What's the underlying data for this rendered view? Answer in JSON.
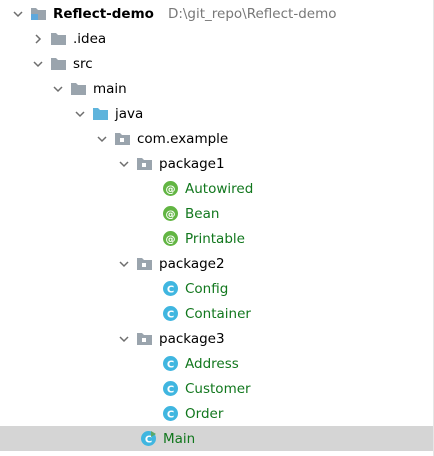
{
  "tree": {
    "root": {
      "label": "Reflect-demo",
      "path": "D:\\git_repo\\Reflect-demo"
    },
    "idea": {
      "label": ".idea"
    },
    "src": {
      "label": "src"
    },
    "main": {
      "label": "main"
    },
    "java": {
      "label": "java"
    },
    "com_example": {
      "label": "com.example"
    },
    "package1": {
      "label": "package1",
      "items": [
        "Autowired",
        "Bean",
        "Printable"
      ]
    },
    "package2": {
      "label": "package2",
      "items": [
        "Config",
        "Container"
      ]
    },
    "package3": {
      "label": "package3",
      "items": [
        "Address",
        "Customer",
        "Order"
      ]
    },
    "main_class": {
      "label": "Main",
      "selected": true
    }
  },
  "colors": {
    "selection": "#d5d5d5",
    "folder": "#9aa4ad",
    "source_folder": "#5fb4dc",
    "annotation_icon": "#62b543",
    "class_icon": "#40b6e0",
    "file_label": "#11771d"
  }
}
